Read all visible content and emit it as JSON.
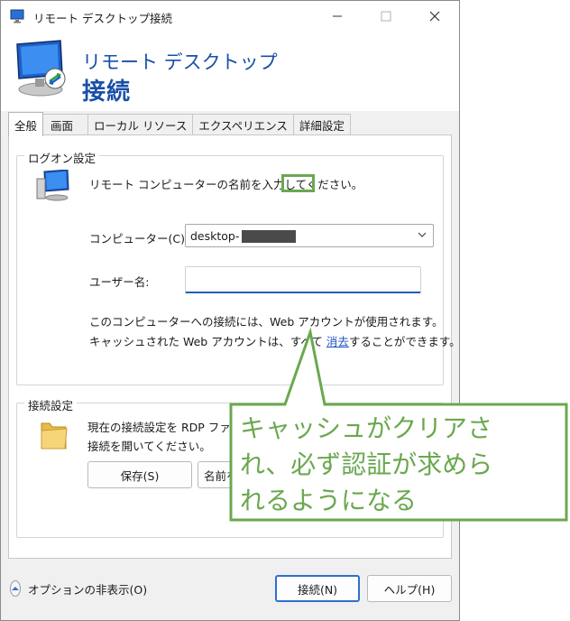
{
  "window": {
    "title": "リモート デスクトップ接続"
  },
  "banner": {
    "line1": "リモート デスクトップ",
    "line2": "接続"
  },
  "tabs": [
    "全般",
    "画面",
    "ローカル リソース",
    "エクスペリエンス",
    "詳細設定"
  ],
  "logon": {
    "group_title": "ログオン設定",
    "instruction": "リモート コンピューターの名前を入力してください。",
    "computer_label": "コンピューター(C):",
    "computer_value": "desktop-",
    "username_label": "ユーザー名:",
    "username_value": "",
    "info_line1": "このコンピューターへの接続には、Web アカウントが使用されます。",
    "info_line2_pre": "キャッシュされた Web アカウントは、すべて",
    "info_link": "消去",
    "info_line2_post": "することができます。"
  },
  "connection": {
    "group_title": "接続設定",
    "desc_line1": "現在の接続設定を RDP ファ",
    "desc_line2": "接続を開いてください。",
    "save_button": "保存(S)",
    "saveas_button": "名前を"
  },
  "footer": {
    "options_toggle": "オプションの非表示(O)",
    "connect_button": "接続(N)",
    "help_button": "ヘルプ(H)"
  },
  "annotation": {
    "text": "キャッシュがクリアさ\nれ、必ず認証が求めら\nれるようになる",
    "color": "#6aa84f"
  }
}
